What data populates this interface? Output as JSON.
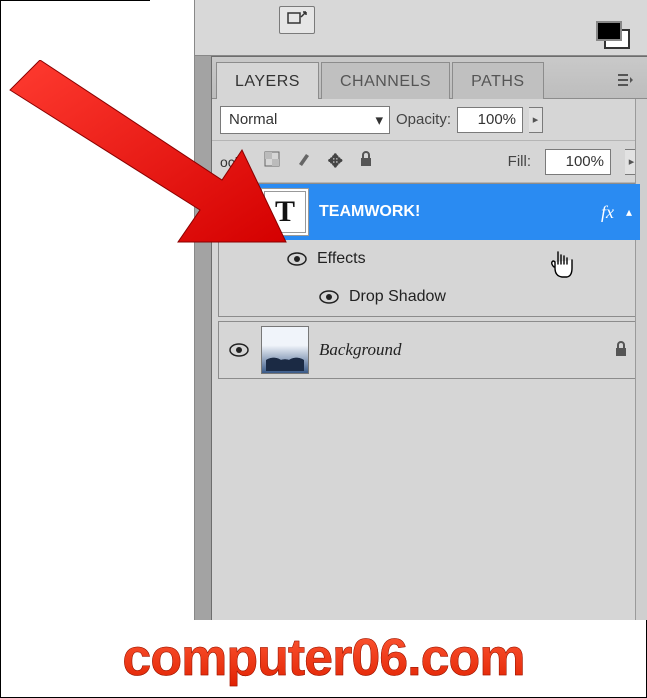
{
  "tabs": {
    "layers": "LAYERS",
    "channels": "CHANNELS",
    "paths": "PATHS"
  },
  "blend_mode": "Normal",
  "opacity": {
    "label": "Opacity:",
    "value": "100%"
  },
  "fill": {
    "label": "Fill:",
    "value": "100%"
  },
  "lock_label": "ock:",
  "layers": {
    "text_layer": {
      "thumb_glyph": "T",
      "name": "TEAMWORK!",
      "fx_symbol": "fx",
      "effects_label": "Effects",
      "drop_shadow_label": "Drop Shadow"
    },
    "background": {
      "name": "Background"
    }
  },
  "watermark": "computer06.com",
  "icons": {
    "swap_arrows": "swap-colors-icon",
    "fgbg": "foreground-background-icon",
    "menu": "panel-menu-icon"
  }
}
